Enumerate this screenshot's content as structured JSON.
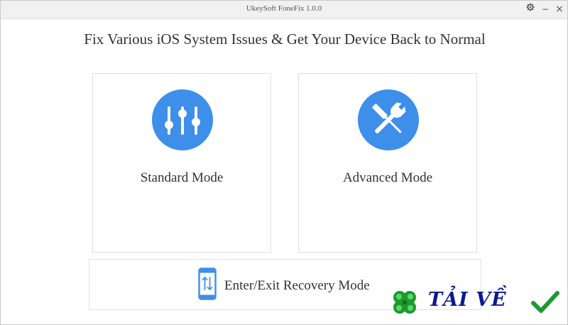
{
  "window": {
    "title": "UkeySoft FoneFix 1.0.0",
    "controls": {
      "settings_icon": "gear-icon",
      "minimize_glyph": "−",
      "close_glyph": "×"
    }
  },
  "main": {
    "headline": "Fix Various iOS System Issues & Get Your Device Back to Normal",
    "cards": [
      {
        "label": "Standard Mode",
        "icon": "sliders-icon"
      },
      {
        "label": "Advanced Mode",
        "icon": "tools-icon"
      }
    ],
    "recovery": {
      "label": "Enter/Exit Recovery Mode",
      "icon": "phone-arrows-icon"
    }
  },
  "watermark": {
    "text": "TẢI VỀ"
  },
  "colors": {
    "accent": "#3d8fea",
    "text": "#333333",
    "border": "#e0e0e0",
    "watermark_text": "#0b1a8c",
    "watermark_green": "#1c9a2e"
  }
}
